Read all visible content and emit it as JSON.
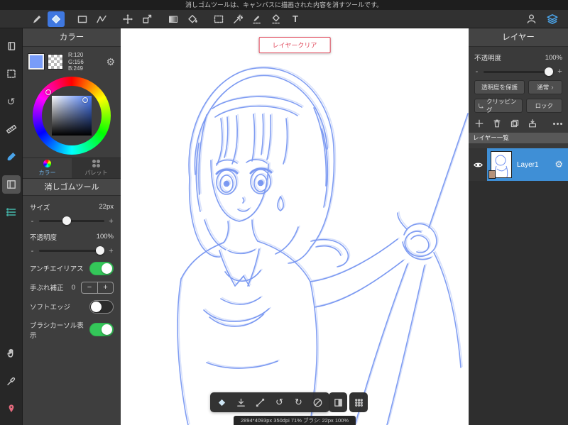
{
  "app": {
    "top_message": "消しゴムツールは、キャンバスに描画された内容を消すツールです。"
  },
  "colors": {
    "accent_blue": "#3f78e0",
    "selected_color": "#789cf9",
    "toggle_on_green": "#34c759",
    "sketch_blue": "#6a8cf0",
    "clear_button_red": "#e0475a",
    "layer_selected_blue": "#3f8fd6"
  },
  "ui": {
    "minus": "-",
    "plus": "+",
    "stepper_minus": "−",
    "stepper_plus": "+",
    "undo": "↺",
    "redo": "↻",
    "gear": "⚙",
    "chevron": "›",
    "text_tool": "T"
  },
  "toolbar": {
    "tools": [
      "pen",
      "eraser",
      "rect-select",
      "polyline-select",
      "move",
      "transform",
      "gradient",
      "bucket",
      "lasso-select",
      "magic-wand",
      "select-pen",
      "select-eraser",
      "text"
    ],
    "selected_tool": "eraser",
    "right_tools": [
      "material",
      "layers"
    ]
  },
  "color_panel": {
    "title": "カラー",
    "rgb": {
      "r": "R:120",
      "g": "G:156",
      "b": "B:249"
    },
    "tabs": [
      {
        "label": "カラー"
      },
      {
        "label": "パレット"
      }
    ]
  },
  "tool_panel": {
    "title": "消しゴムツール",
    "size": {
      "label": "サイズ",
      "value": "22px"
    },
    "opacity": {
      "label": "不透明度",
      "value": "100%"
    },
    "antialias": {
      "label": "アンチエイリアス",
      "on": true
    },
    "stabilize": {
      "label": "手ぶれ補正",
      "value": "0"
    },
    "soft_edge": {
      "label": "ソフトエッジ",
      "on": false
    },
    "brush_cursor": {
      "label": "ブラシカーソル表示",
      "on": true
    }
  },
  "canvas": {
    "clear_button": "レイヤークリア"
  },
  "status_bar": {
    "text": "2894*4093px 350dpi 71% ブラシ: 22px 100%"
  },
  "layer_panel": {
    "title": "レイヤー",
    "opacity": {
      "label": "不透明度",
      "value": "100%"
    },
    "protect_button": "透明度を保護",
    "blend_button": "通常",
    "clipping_button": "クリッピング",
    "lock_button": "ロック",
    "list_title": "レイヤー一覧",
    "layers": [
      {
        "name": "Layer1",
        "selected": true,
        "visible": true
      }
    ]
  }
}
